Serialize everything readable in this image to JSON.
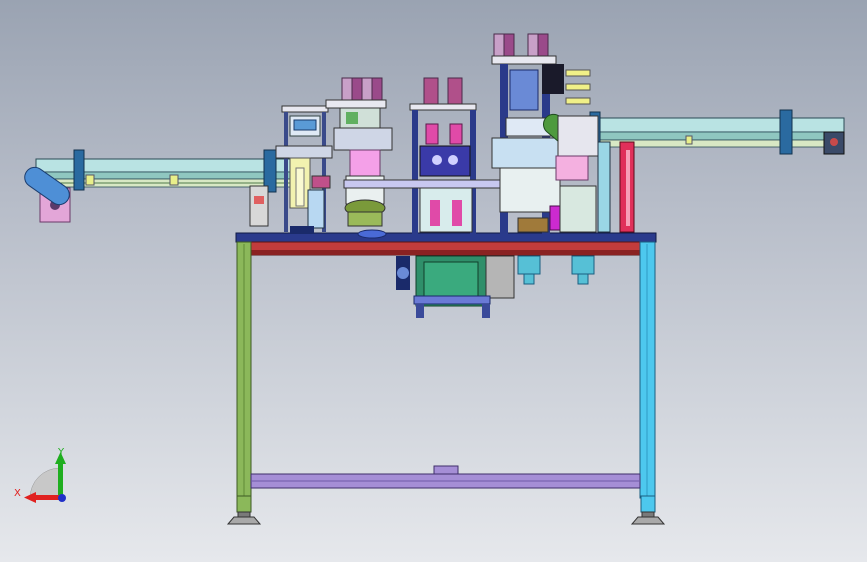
{
  "triad": {
    "x_label": "X",
    "y_label": "Y",
    "x_color": "#e0201e",
    "y_color": "#1fae1f",
    "z_color": "#2030c8"
  },
  "colors": {
    "frame_left_leg": "#8bb85a",
    "frame_right_leg": "#4dc8ee",
    "top_plate": "#2a3a8c",
    "red_beam": "#b83838",
    "bottom_bar": "#a58ed6",
    "conveyor": "#a7d9d5",
    "motor": "#2f8f6a"
  }
}
